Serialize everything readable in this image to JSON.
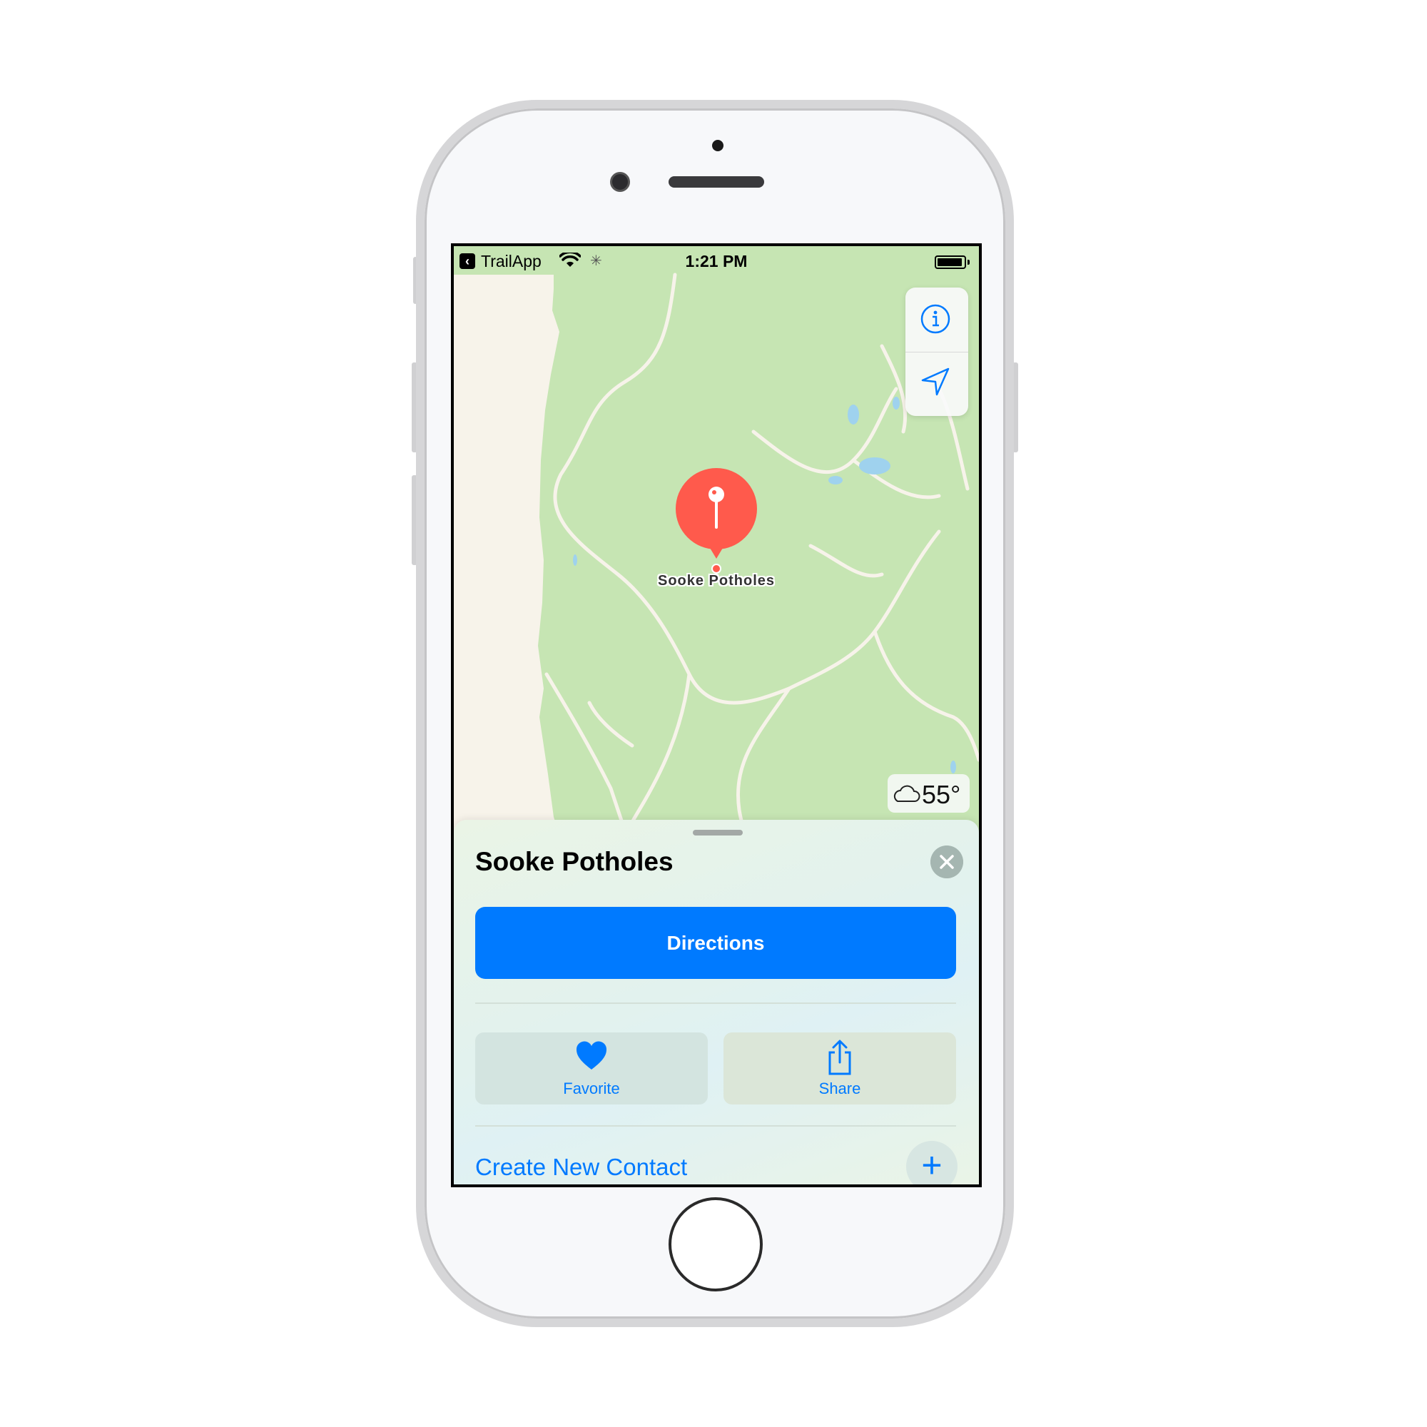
{
  "status_bar": {
    "back_app": "TrailApp",
    "time": "1:21 PM",
    "battery_level": 0.95
  },
  "map": {
    "pin_label": "Sooke Potholes",
    "weather": {
      "icon": "cloud-icon",
      "temperature": "55°"
    },
    "controls": [
      {
        "name": "info-icon"
      },
      {
        "name": "location-arrow-icon"
      }
    ]
  },
  "sheet": {
    "title": "Sooke Potholes",
    "directions_label": "Directions",
    "favorite_label": "Favorite",
    "share_label": "Share",
    "create_contact_label": "Create New Contact"
  },
  "colors": {
    "accent": "#007aff",
    "pin": "#ff5a4c",
    "park": "#c6e5b3",
    "land": "#f7f3ea",
    "water": "#9fd2ee"
  }
}
